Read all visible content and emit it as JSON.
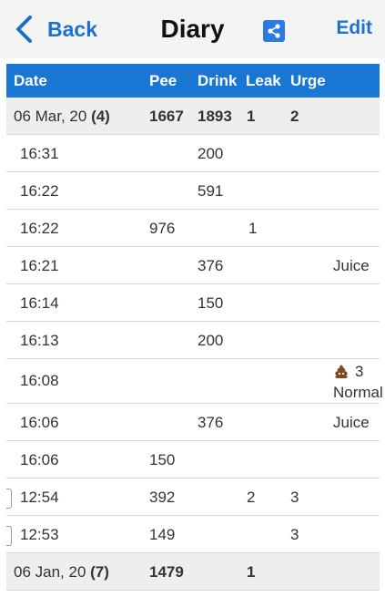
{
  "header": {
    "back_label": "Back",
    "title": "Diary",
    "edit_label": "Edit"
  },
  "icons": {
    "back": "chevron-left-icon",
    "share": "share-icon",
    "poop": "poop-icon"
  },
  "colors": {
    "accent": "#1f6fd0",
    "table_header": "#1976d2",
    "group_row": "#eeeeee"
  },
  "columns": {
    "date": "Date",
    "pee": "Pee",
    "drink": "Drink",
    "leak": "Leak",
    "urge": "Urge"
  },
  "groups": [
    {
      "date": "06 Mar, 20",
      "count": "(4)",
      "pee": "1667",
      "drink": "1893",
      "leak": "1",
      "urge": "2"
    },
    {
      "date": "06 Jan, 20",
      "count": "(7)",
      "pee": "1479",
      "drink": "",
      "leak": "1",
      "urge": ""
    }
  ],
  "entries": [
    {
      "time": "16:31",
      "pee": "",
      "drink": "200",
      "leak": "",
      "urge": "",
      "note": ""
    },
    {
      "time": "16:22",
      "pee": "",
      "drink": "591",
      "leak": "",
      "urge": "",
      "note": ""
    },
    {
      "time": "16:22",
      "pee": "976",
      "drink": "",
      "leak": "1",
      "urge": "",
      "note": ""
    },
    {
      "time": "16:21",
      "pee": "",
      "drink": "376",
      "leak": "",
      "urge": "",
      "note": "Juice"
    },
    {
      "time": "16:14",
      "pee": "",
      "drink": "150",
      "leak": "",
      "urge": "",
      "note": ""
    },
    {
      "time": "16:13",
      "pee": "",
      "drink": "200",
      "leak": "",
      "urge": "",
      "note": ""
    },
    {
      "time": "16:08",
      "pee": "",
      "drink": "",
      "leak": "",
      "urge": "",
      "note": "3",
      "note2": "Normal"
    },
    {
      "time": "16:06",
      "pee": "",
      "drink": "376",
      "leak": "",
      "urge": "",
      "note": "Juice"
    },
    {
      "time": "16:06",
      "pee": "150",
      "drink": "",
      "leak": "",
      "urge": "",
      "note": ""
    },
    {
      "time": "12:54",
      "pee": "392",
      "drink": "",
      "leak": "2",
      "urge": "3",
      "note": ""
    },
    {
      "time": "12:53",
      "pee": "149",
      "drink": "",
      "leak": "",
      "urge": "3",
      "note": ""
    }
  ]
}
